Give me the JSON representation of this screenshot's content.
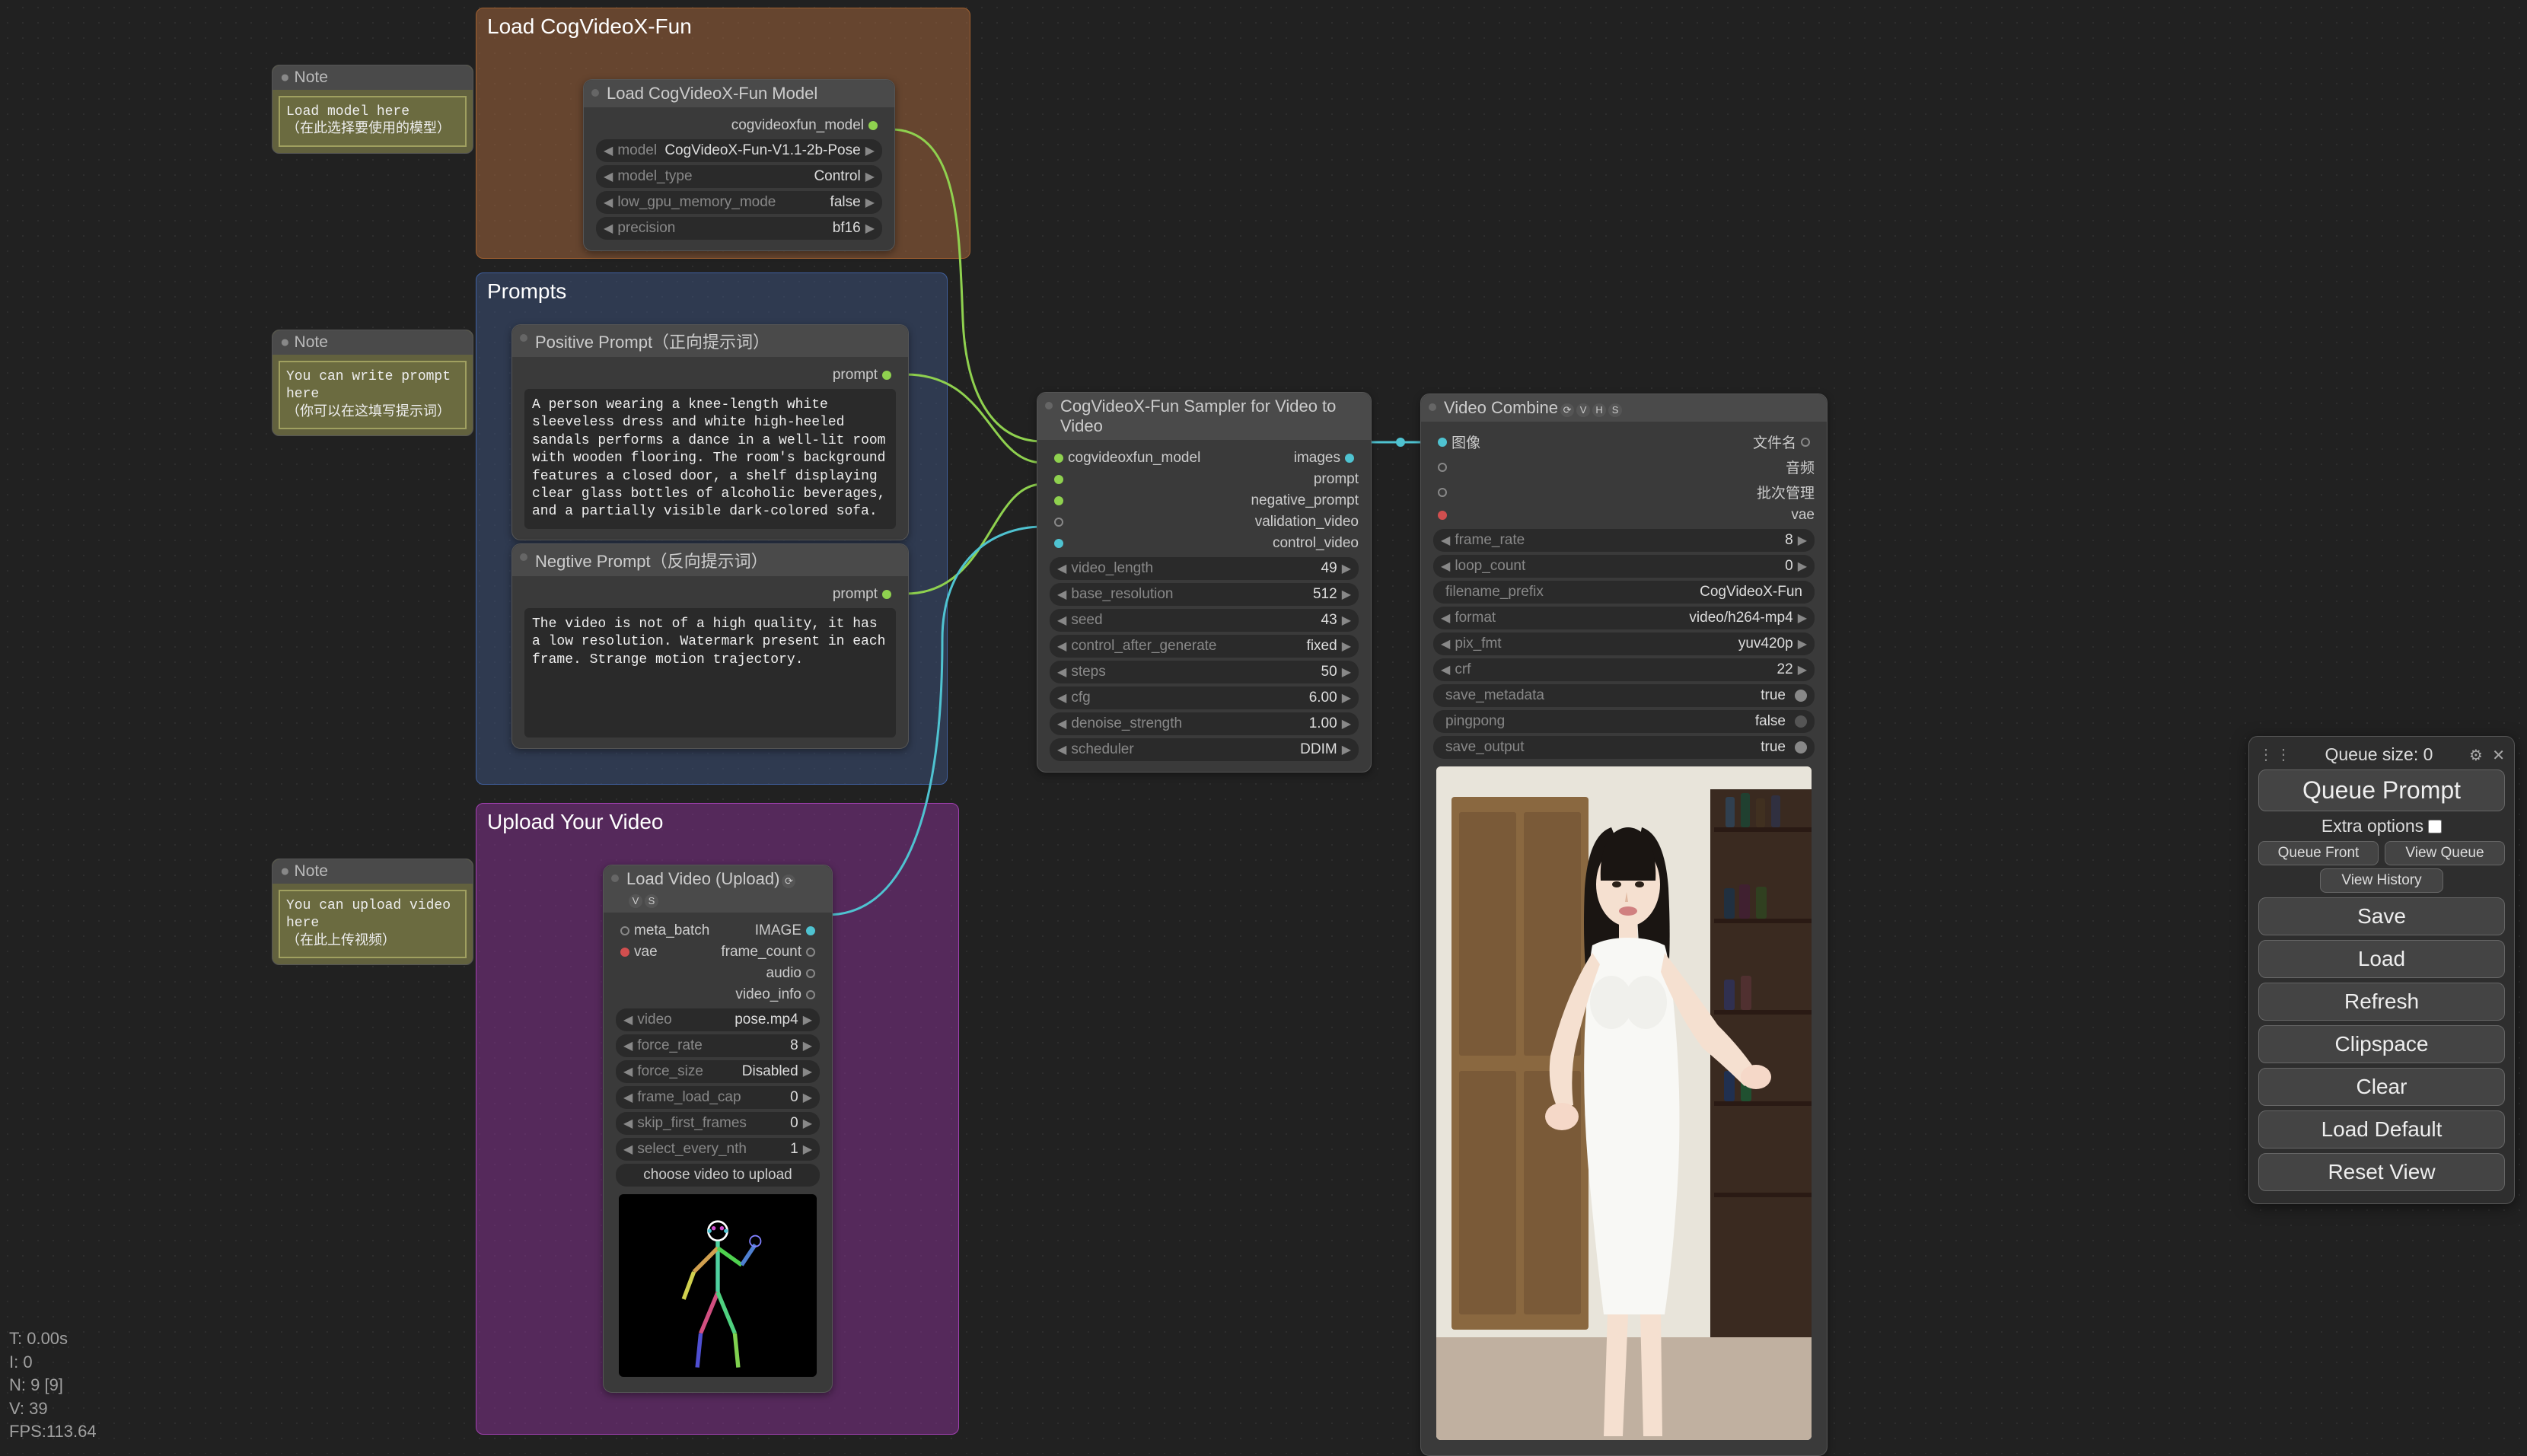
{
  "groups": {
    "g1_title": "Load CogVideoX-Fun",
    "g2_title": "Prompts",
    "g3_title": "Upload Your Video"
  },
  "notes": {
    "n1_title": "Note",
    "n1_body": "Load model here\n（在此选择要使用的模型）",
    "n2_title": "Note",
    "n2_body": "You can write prompt here\n（你可以在这填写提示词）",
    "n3_title": "Note",
    "n3_body": "You can upload video here\n（在此上传视频）"
  },
  "node_load": {
    "title": "Load CogVideoX-Fun Model",
    "out_port": "cogvideoxfun_model",
    "w_model_label": "model",
    "w_model_val": "CogVideoX-Fun-V1.1-2b-Pose",
    "w_type_label": "model_type",
    "w_type_val": "Control",
    "w_low_label": "low_gpu_memory_mode",
    "w_low_val": "false",
    "w_prec_label": "precision",
    "w_prec_val": "bf16"
  },
  "node_pos": {
    "title": "Positive Prompt（正向提示词）",
    "out_port": "prompt",
    "text": "A person wearing a knee-length white sleeveless dress and white high-heeled sandals performs a dance in a well-lit room with wooden flooring. The room's background features a closed door, a shelf displaying clear glass bottles of alcoholic beverages, and a partially visible dark-colored sofa."
  },
  "node_neg": {
    "title": "Negtive Prompt（反向提示词）",
    "out_port": "prompt",
    "text": "The video is not of a high quality, it has a low resolution. Watermark present in each frame. Strange motion trajectory."
  },
  "node_video": {
    "title": "Load Video (Upload)",
    "in_meta": "meta_batch",
    "in_vae": "vae",
    "out_image": "IMAGE",
    "out_fc": "frame_count",
    "out_audio": "audio",
    "out_info": "video_info",
    "w_video_label": "video",
    "w_video_val": "pose.mp4",
    "w_fr_label": "force_rate",
    "w_fr_val": "8",
    "w_fs_label": "force_size",
    "w_fs_val": "Disabled",
    "w_flc_label": "frame_load_cap",
    "w_flc_val": "0",
    "w_sff_label": "skip_first_frames",
    "w_sff_val": "0",
    "w_sen_label": "select_every_nth",
    "w_sen_val": "1",
    "choose": "choose video to upload"
  },
  "node_sampler": {
    "title": "CogVideoX-Fun Sampler for Video to Video",
    "in_model": "cogvideoxfun_model",
    "in_prompt": "prompt",
    "in_neg": "negative_prompt",
    "in_val": "validation_video",
    "in_ctrl": "control_video",
    "out_images": "images",
    "w_vl_label": "video_length",
    "w_vl_val": "49",
    "w_br_label": "base_resolution",
    "w_br_val": "512",
    "w_seed_label": "seed",
    "w_seed_val": "43",
    "w_cag_label": "control_after_generate",
    "w_cag_val": "fixed",
    "w_steps_label": "steps",
    "w_steps_val": "50",
    "w_cfg_label": "cfg",
    "w_cfg_val": "6.00",
    "w_ds_label": "denoise_strength",
    "w_ds_val": "1.00",
    "w_sch_label": "scheduler",
    "w_sch_val": "DDIM"
  },
  "node_combine": {
    "title": "Video Combine",
    "in_img": "图像",
    "in_audio": "音频",
    "in_batch": "批次管理",
    "in_vae": "vae",
    "out_file": "文件名",
    "w_fr_label": "frame_rate",
    "w_fr_val": "8",
    "w_lc_label": "loop_count",
    "w_lc_val": "0",
    "w_fp_label": "filename_prefix",
    "w_fp_val": "CogVideoX-Fun",
    "w_fmt_label": "format",
    "w_fmt_val": "video/h264-mp4",
    "w_pix_label": "pix_fmt",
    "w_pix_val": "yuv420p",
    "w_crf_label": "crf",
    "w_crf_val": "22",
    "w_sm_label": "save_metadata",
    "w_sm_val": "true",
    "w_pp_label": "pingpong",
    "w_pp_val": "false",
    "w_so_label": "save_output",
    "w_so_val": "true"
  },
  "panel": {
    "queue_size_label": "Queue size:",
    "queue_size_val": "0",
    "queue_prompt": "Queue Prompt",
    "extra_options": "Extra options",
    "queue_front": "Queue Front",
    "view_queue": "View Queue",
    "view_history": "View History",
    "save": "Save",
    "load": "Load",
    "refresh": "Refresh",
    "clipspace": "Clipspace",
    "clear": "Clear",
    "load_default": "Load Default",
    "reset_view": "Reset View"
  },
  "stats": {
    "t": "T: 0.00s",
    "i": "I: 0",
    "n": "N: 9 [9]",
    "v": "V: 39",
    "fps": "FPS:113.64"
  }
}
